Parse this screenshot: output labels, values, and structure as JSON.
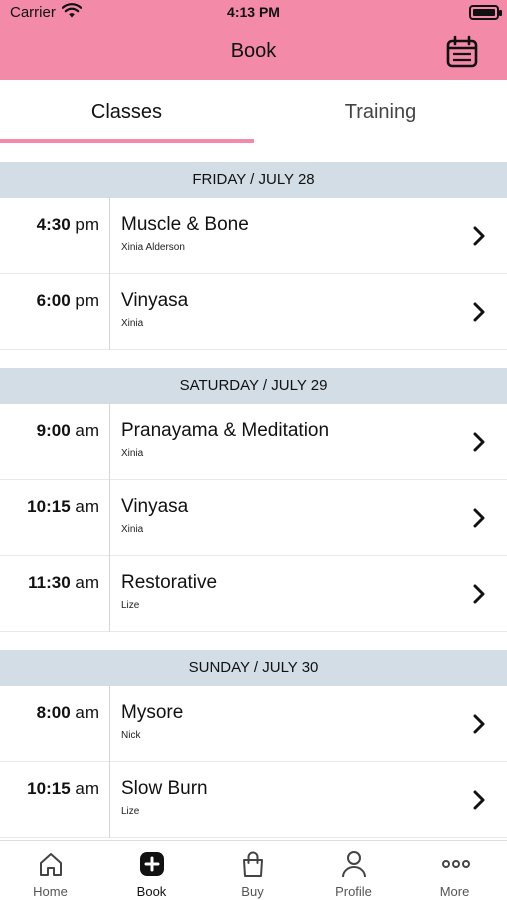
{
  "status": {
    "carrier": "Carrier",
    "time": "4:13 PM"
  },
  "header": {
    "title": "Book"
  },
  "tabs": [
    {
      "label": "Classes",
      "active": true
    },
    {
      "label": "Training",
      "active": false
    }
  ],
  "days": [
    {
      "label": "FRIDAY / JULY 28",
      "classes": [
        {
          "time": "4:30",
          "period": " pm",
          "name": "Muscle & Bone",
          "instructor": "Xinia Alderson"
        },
        {
          "time": "6:00",
          "period": " pm",
          "name": "Vinyasa",
          "instructor": "Xinia"
        }
      ]
    },
    {
      "label": "SATURDAY / JULY 29",
      "classes": [
        {
          "time": "9:00",
          "period": " am",
          "name": "Pranayama & Meditation",
          "instructor": "Xinia"
        },
        {
          "time": "10:15",
          "period": " am",
          "name": "Vinyasa",
          "instructor": "Xinia"
        },
        {
          "time": "11:30",
          "period": " am",
          "name": "Restorative",
          "instructor": "Lize"
        }
      ]
    },
    {
      "label": "SUNDAY / JULY 30",
      "classes": [
        {
          "time": "8:00",
          "period": " am",
          "name": "Mysore",
          "instructor": "Nick"
        },
        {
          "time": "10:15",
          "period": " am",
          "name": "Slow Burn",
          "instructor": "Lize"
        }
      ]
    }
  ],
  "tabbar": [
    {
      "label": "Home",
      "icon": "home-icon",
      "active": false
    },
    {
      "label": "Book",
      "icon": "plus-square-icon",
      "active": true
    },
    {
      "label": "Buy",
      "icon": "shopping-bag-icon",
      "active": false
    },
    {
      "label": "Profile",
      "icon": "person-icon",
      "active": false
    },
    {
      "label": "More",
      "icon": "more-dots-icon",
      "active": false
    }
  ],
  "colors": {
    "accent": "#f28aa8",
    "day_header_bg": "#d2dde6"
  }
}
